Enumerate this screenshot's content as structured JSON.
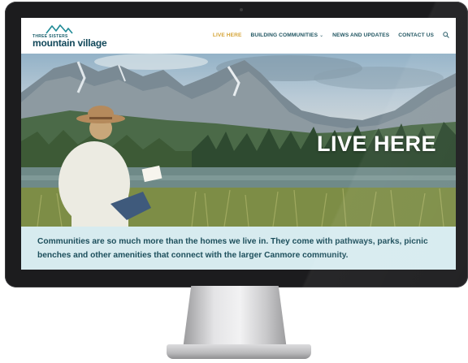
{
  "site": {
    "logo_small": "THREE SISTERS",
    "logo_big": "mountain village"
  },
  "nav": {
    "items": [
      {
        "label": "LIVE HERE",
        "active": true
      },
      {
        "label": "BUILDING COMMUNITIES",
        "has_dropdown": true
      },
      {
        "label": "NEWS AND UPDATES"
      },
      {
        "label": "CONTACT US"
      }
    ],
    "search_icon": "search-icon"
  },
  "hero": {
    "title": "LIVE HERE"
  },
  "intro": {
    "text": "Communities are so much more than the homes we live in. They come with pathways, parks, picnic benches and other amenities that connect with the larger Canmore community."
  },
  "colors": {
    "accent": "#d4a437",
    "brand": "#1b5e6b",
    "intro_bg": "#d7ebef"
  }
}
